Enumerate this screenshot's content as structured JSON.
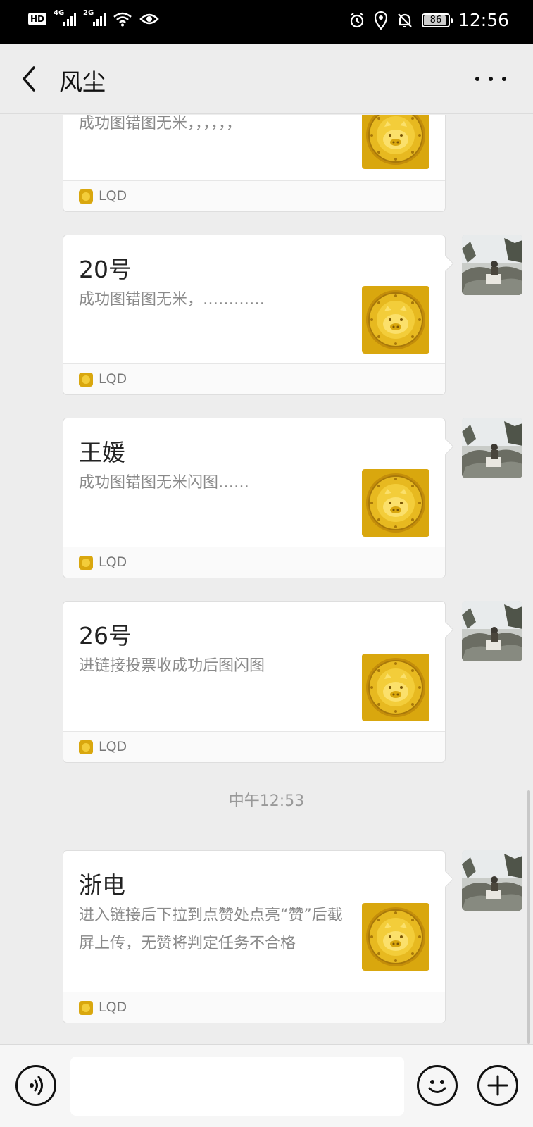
{
  "status_bar": {
    "hd": "HD",
    "sig1_label": "4G",
    "sig2_label": "2G",
    "battery": "86",
    "time": "12:56"
  },
  "header": {
    "title": "风尘"
  },
  "messages": [
    {
      "title": "",
      "desc": "成功图错图无米，，，，，，",
      "footer": "LQD"
    },
    {
      "title": "20号",
      "desc": "成功图错图无米，…………",
      "footer": "LQD"
    },
    {
      "title": "王媛",
      "desc": "成功图错图无米闪图……",
      "footer": "LQD"
    },
    {
      "title": "26号",
      "desc": "进链接投票收成功后图闪图",
      "footer": "LQD"
    },
    {
      "title": "浙电",
      "desc": "进入链接后下拉到点赞处点亮“赞”后截屏上传，无赞将判定任务不合格",
      "footer": "LQD"
    }
  ],
  "timestamp": "中午12:53",
  "colors": {
    "bg": "#ededed",
    "coin": "#d9a70e"
  }
}
